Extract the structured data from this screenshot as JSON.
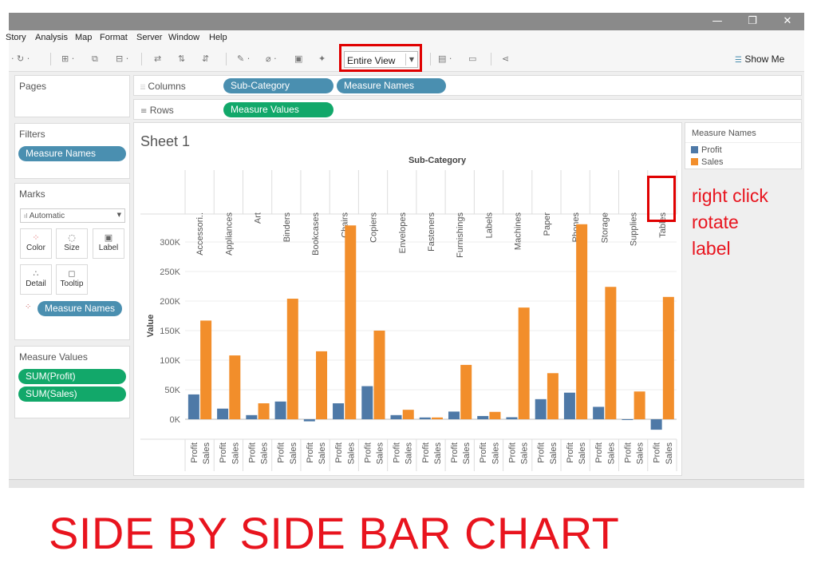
{
  "window": {
    "minimize_glyph": "—",
    "restore_glyph": "❐",
    "close_glyph": "✕"
  },
  "menu": [
    "Story",
    "Analysis",
    "Map",
    "Format",
    "Server",
    "Window",
    "Help"
  ],
  "toolbar": {
    "fit_value": "Entire View",
    "show_me_label": "Show Me"
  },
  "shelves": {
    "pages_title": "Pages",
    "filters_title": "Filters",
    "filter_pill": "Measure Names",
    "marks_title": "Marks",
    "mark_type": "Automatic",
    "mark_buttons": [
      "Color",
      "Size",
      "Label",
      "Detail",
      "Tooltip"
    ],
    "marks_pill": "Measure Names",
    "measure_values_title": "Measure Values",
    "measure_values_pills": [
      "SUM(Profit)",
      "SUM(Sales)"
    ],
    "columns_label": "Columns",
    "columns_pills": [
      "Sub-Category",
      "Measure Names"
    ],
    "rows_label": "Rows",
    "rows_pills": [
      "Measure Values"
    ]
  },
  "sheet": {
    "title": "Sheet 1"
  },
  "legend": {
    "title": "Measure Names",
    "items": [
      {
        "name": "Profit",
        "color": "#4e79a7"
      },
      {
        "name": "Sales",
        "color": "#f28e2b"
      }
    ]
  },
  "annotation": {
    "lines": [
      "right click",
      "rotate",
      "label"
    ]
  },
  "caption": "SIDE BY SIDE BAR CHART",
  "chart_data": {
    "type": "bar",
    "title": "",
    "xlabel": "Sub-Category",
    "ylabel": "Value",
    "categories": [
      "Accessori..",
      "Appliances",
      "Art",
      "Binders",
      "Bookcases",
      "Chairs",
      "Copiers",
      "Envelopes",
      "Fasteners",
      "Furnishings",
      "Labels",
      "Machines",
      "Paper",
      "Phones",
      "Storage",
      "Supplies",
      "Tables"
    ],
    "bar_labels": [
      "Profit",
      "Sales"
    ],
    "series": [
      {
        "name": "Profit",
        "color": "#4e79a7",
        "values": [
          42000,
          18000,
          7000,
          30000,
          -3500,
          27000,
          56000,
          7000,
          3000,
          13000,
          5500,
          3400,
          34000,
          45000,
          21000,
          -1200,
          -17700
        ]
      },
      {
        "name": "Sales",
        "color": "#f28e2b",
        "values": [
          167000,
          108000,
          27000,
          204000,
          115000,
          328000,
          150000,
          16000,
          3000,
          92000,
          12500,
          189000,
          78000,
          330000,
          224000,
          47000,
          207000
        ]
      }
    ],
    "ylim": [
      -20000,
      340000
    ],
    "yticks": [
      0,
      50000,
      100000,
      150000,
      200000,
      250000,
      300000
    ],
    "ytick_labels": [
      "0K",
      "50K",
      "100K",
      "150K",
      "200K",
      "250K",
      "300K"
    ],
    "grid": true
  }
}
